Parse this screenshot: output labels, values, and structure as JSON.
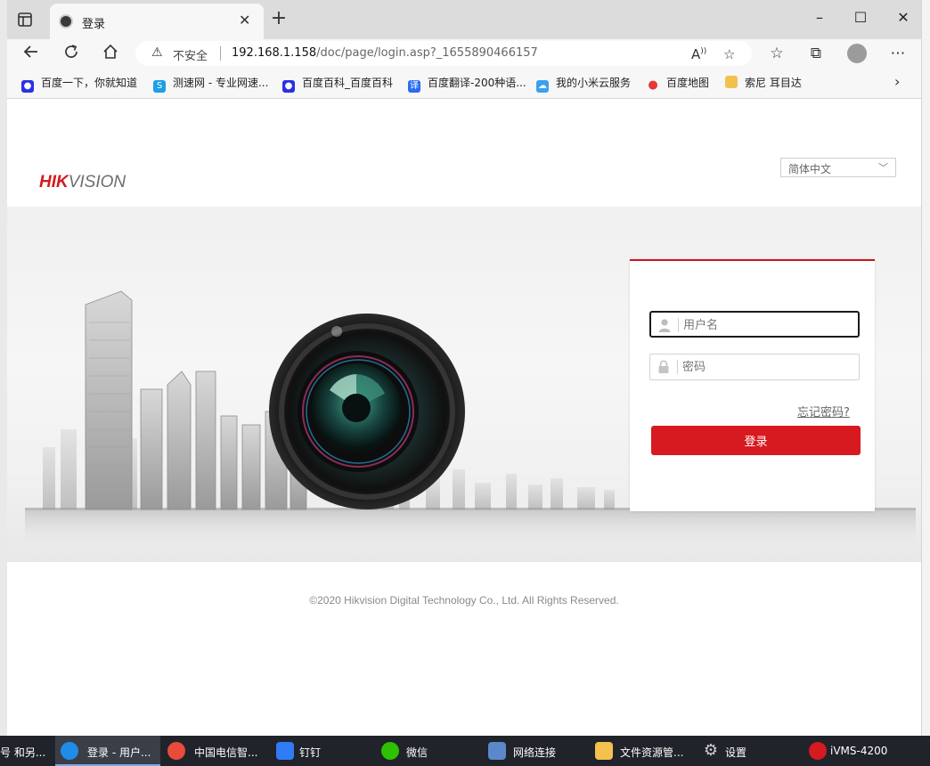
{
  "browser": {
    "tab": {
      "title": "登录"
    },
    "new_tab_glyph": "+",
    "window_controls": {
      "minimize": "–",
      "maximize": "☐",
      "close": "✕"
    },
    "address": {
      "insecure_label": "不安全",
      "host": "192.168.1.158",
      "path": "/doc/page/login.asp?_1655890466157"
    },
    "bookmarks": [
      {
        "label": "百度一下，你就知道",
        "icon": "baidu-paw-icon",
        "color": "#2932e1"
      },
      {
        "label": "测速网 - 专业网速...",
        "icon": "speedtest-icon",
        "color": "#1aa0e6"
      },
      {
        "label": "百度百科_百度百科",
        "icon": "baidu-paw-icon",
        "color": "#2932e1"
      },
      {
        "label": "百度翻译-200种语...",
        "icon": "translate-icon",
        "color": "#2b6cf0"
      },
      {
        "label": "我的小米云服务",
        "icon": "cloud-icon",
        "color": "#3aa0f0"
      },
      {
        "label": "百度地图",
        "icon": "map-pin-icon",
        "color": "#e53935"
      },
      {
        "label": "索尼 耳目达",
        "icon": "folder-icon",
        "color": "#f2c14e"
      }
    ]
  },
  "page": {
    "brand": {
      "hik": "HIK",
      "vision": "VISION"
    },
    "language": {
      "selected": "简体中文"
    },
    "login": {
      "username_placeholder": "用户名",
      "password_placeholder": "密码",
      "forgot_label": "忘记密码?",
      "submit_label": "登录"
    },
    "copyright": "©2020 Hikvision Digital Technology Co., Ltd. All Rights Reserved."
  },
  "taskbar": {
    "items": [
      {
        "label": "号 和另...",
        "color": "#20232a"
      },
      {
        "label": "登录 - 用户...",
        "color": "#1f8de8",
        "active": true
      },
      {
        "label": "中国电信智...",
        "color": "#e84b3c"
      },
      {
        "label": "钉钉",
        "color": "#2f7cf6"
      },
      {
        "label": "微信",
        "color": "#2dc100"
      },
      {
        "label": "网络连接",
        "color": "#5a88c8"
      },
      {
        "label": "文件资源管...",
        "color": "#f2c14e"
      },
      {
        "label": "设置",
        "color": "#cfcfcf"
      },
      {
        "label": "iVMS-4200",
        "color": "#d71920"
      }
    ]
  },
  "colors": {
    "accent": "#d71920",
    "brand_gray": "#6e6e6e"
  }
}
